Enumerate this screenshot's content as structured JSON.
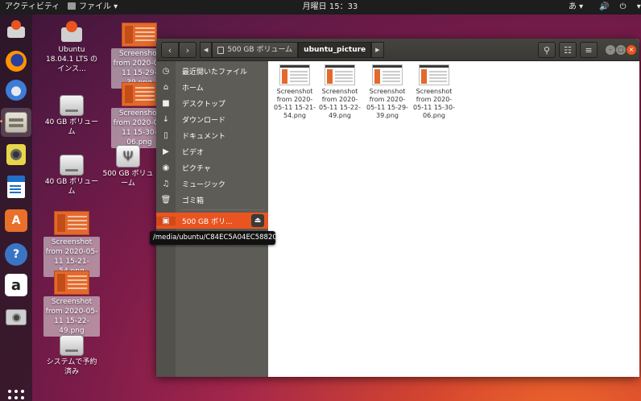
{
  "topbar": {
    "activities": "アクティビティ",
    "app_menu": "ファイル ▾",
    "clock": "月曜日 15：33",
    "input_method": "あ ▾",
    "system_indicators": "🔊 ⏻ ▾"
  },
  "dock": {
    "items": [
      {
        "name": "Ubuntu Software installer",
        "icon": "installer-icon"
      },
      {
        "name": "Firefox",
        "icon": "firefox-icon"
      },
      {
        "name": "Thunderbird",
        "icon": "thunderbird-icon"
      },
      {
        "name": "Files",
        "icon": "files-icon",
        "active": true
      },
      {
        "name": "Rhythmbox",
        "icon": "rhythmbox-icon"
      },
      {
        "name": "LibreOffice Writer",
        "icon": "writer-icon"
      },
      {
        "name": "Ubuntu Software",
        "icon": "software-center-icon"
      },
      {
        "name": "Help",
        "icon": "help-icon",
        "glyph": "?"
      },
      {
        "name": "Amazon",
        "icon": "amazon-icon",
        "glyph": "a"
      },
      {
        "name": "Camera",
        "icon": "camera-icon"
      }
    ],
    "show_apps_icon": "app-grid-icon"
  },
  "desktop": {
    "icons": [
      {
        "label": "Ubuntu 18.04.1 LTS のインス...",
        "type": "installer"
      },
      {
        "label": "40 GB ボリューム",
        "type": "drive"
      },
      {
        "label": "40 GB ボリューム",
        "type": "drive"
      },
      {
        "label": "Screenshot from 2020-05-11 15-21-54.png",
        "type": "png"
      },
      {
        "label": "Screenshot from 2020-05-11 15-22-49.png",
        "type": "png"
      },
      {
        "label": "システムで予約済み",
        "type": "drive"
      },
      {
        "label": "Screenshot from 2020-05-11 15-29-39.png",
        "type": "png"
      },
      {
        "label": "Screenshot from 2020-05-11 15-30-06.png",
        "type": "png"
      },
      {
        "label": "500 GB ボリューム",
        "type": "usb"
      }
    ]
  },
  "files_window": {
    "path": [
      {
        "label": "500 GB ボリューム"
      },
      {
        "label": "ubuntu_picture",
        "current": true
      }
    ],
    "sidebar": [
      {
        "label": "最近開いたファイル",
        "icon": "clock-icon"
      },
      {
        "label": "ホーム",
        "icon": "home-icon"
      },
      {
        "label": "デスクトップ",
        "icon": "folder-icon"
      },
      {
        "label": "ダウンロード",
        "icon": "download-icon"
      },
      {
        "label": "ドキュメント",
        "icon": "document-icon"
      },
      {
        "label": "ビデオ",
        "icon": "video-icon"
      },
      {
        "label": "ピクチャ",
        "icon": "camera-icon"
      },
      {
        "label": "ミュージック",
        "icon": "music-icon"
      },
      {
        "label": "ゴミ箱",
        "icon": "trash-icon"
      },
      {
        "label": "500 GB ボリ...",
        "icon": "drive-icon",
        "selected": true
      }
    ],
    "files": [
      {
        "name": "Screenshot from 2020-05-11 15-21-54.png"
      },
      {
        "name": "Screenshot from 2020-05-11 15-22-49.png"
      },
      {
        "name": "Screenshot from 2020-05-11 15-29-39.png"
      },
      {
        "name": "Screenshot from 2020-05-11 15-30-06.png"
      }
    ]
  },
  "tooltip": {
    "text": "/media/ubuntu/C84EC5A04EC58820"
  },
  "colors": {
    "accent": "#e95420",
    "header": "#3c3b37",
    "sidebar": "#5d5c56"
  }
}
